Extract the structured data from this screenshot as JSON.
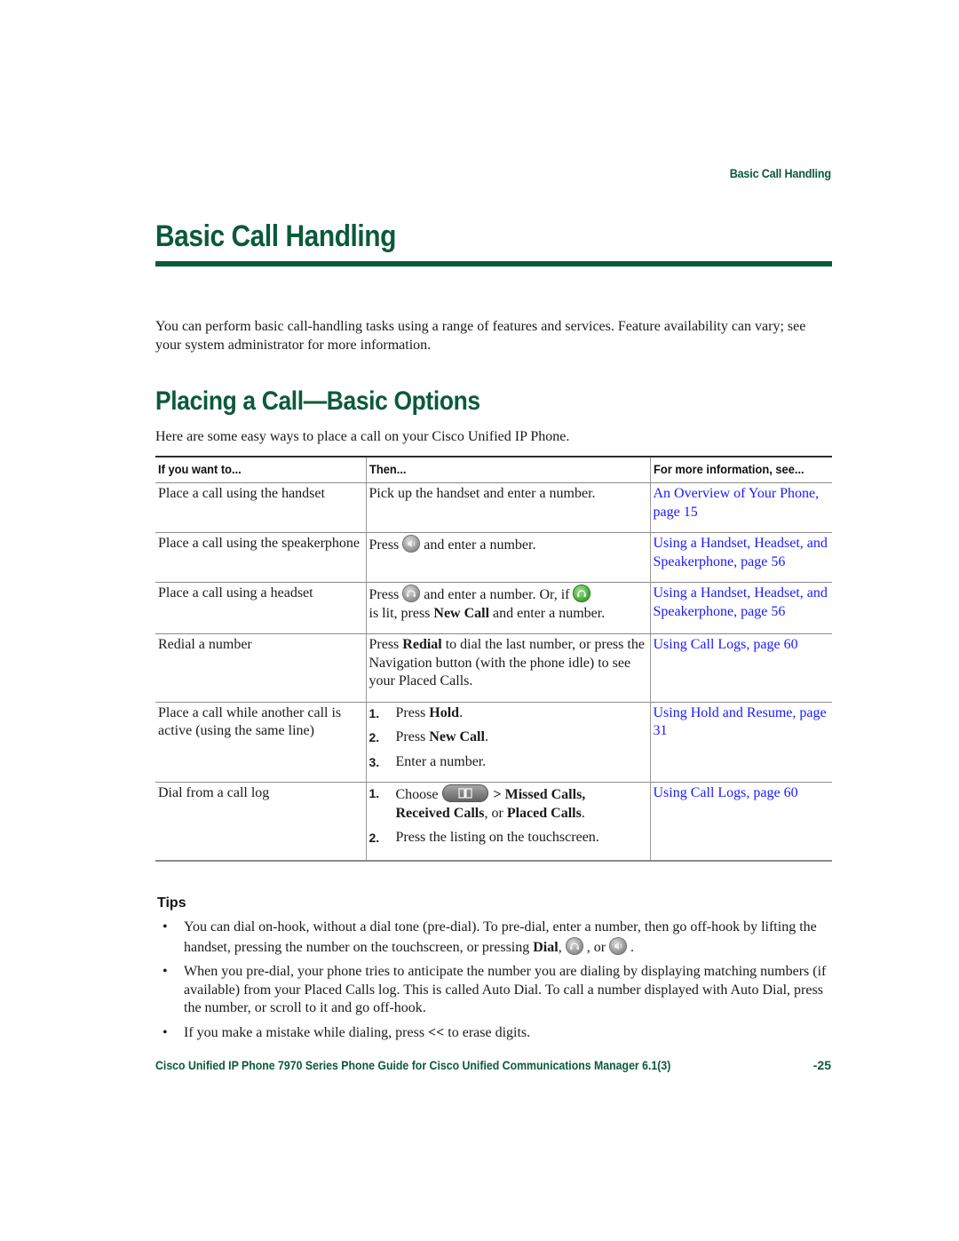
{
  "running_header": "Basic Call Handling",
  "page_title": "Basic Call Handling",
  "intro": "You can perform basic call-handling tasks using a range of features and services. Feature availability can vary; see your system administrator for more information.",
  "section": {
    "title": "Placing a Call—Basic Options",
    "intro": "Here are some easy ways to place a call on your Cisco Unified IP Phone."
  },
  "table": {
    "headers": [
      "If you want to...",
      "Then...",
      "For more information, see..."
    ],
    "rows": [
      {
        "want": "Place a call using the handset",
        "then": "Pick up the handset and enter a number.",
        "see": "An Overview of Your Phone, page 15"
      },
      {
        "want": "Place a call using the speakerphone",
        "then_pre": "Press",
        "then_icon": "speaker-icon",
        "then_post": "and enter a number.",
        "see": "Using a Handset, Headset, and Speakerphone, page 56"
      },
      {
        "want": "Place a call using a headset",
        "then_pre": "Press",
        "then_icon": "headset-icon",
        "then_mid": "and enter a number. Or, if",
        "then_icon2": "headset-lit-icon",
        "then_mid2": "is lit, press",
        "then_bold": "New Call",
        "then_post": "and enter a number.",
        "see": "Using a Handset, Headset, and Speakerphone, page 56"
      },
      {
        "want": "Redial a number",
        "then_pre": "Press",
        "then_bold": "Redial",
        "then_post": "to dial the last number, or press the Navigation button (with the phone idle) to see your Placed Calls.",
        "see": "Using Call Logs, page 60"
      },
      {
        "want": "Place a call while another call is active (using the same line)",
        "steps": [
          {
            "num": "1.",
            "pre": "Press",
            "bold": "Hold",
            "post": "."
          },
          {
            "num": "2.",
            "pre": "Press",
            "bold": "New Call",
            "post": "."
          },
          {
            "num": "3.",
            "pre": "Enter a number.",
            "bold": "",
            "post": ""
          }
        ],
        "see": "Using Hold and Resume, page 31"
      },
      {
        "want": "Dial from a call log",
        "steps": [
          {
            "num": "1.",
            "pre": "Choose",
            "icon": "directories-icon",
            "bold": "> Missed Calls,",
            "line2_bold1": "Received Calls",
            "line2_mid": ", or",
            "line2_bold2": "Placed Calls",
            "line2_post": "."
          },
          {
            "num": "2.",
            "pre": "Press the listing on the touchscreen."
          }
        ],
        "see": "Using Call Logs, page 60"
      }
    ]
  },
  "tips": {
    "heading": "Tips",
    "bullet": "•",
    "items": [
      {
        "pre": "You can dial on-hook, without a dial tone (pre-dial). To pre-dial, enter a number, then go off-hook by lifting the handset, pressing the number on the touchscreen, or pressing",
        "bold": "Dial",
        "icons": [
          "headset-icon",
          "speaker-icon"
        ],
        "sep1": ",",
        "sep2": ", or",
        "end": "."
      },
      {
        "text": "When you pre-dial, your phone tries to anticipate the number you are dialing by displaying matching numbers (if available) from your Placed Calls log. This is called Auto Dial. To call a number displayed with Auto Dial, press the number, or scroll to it and go off-hook."
      },
      {
        "pre": "If you make a mistake while dialing, press",
        "bold": "<<",
        "post": "to erase digits."
      }
    ]
  },
  "footer": {
    "title": "Cisco Unified IP Phone 7970 Series Phone Guide for Cisco Unified Communications Manager 6.1(3)",
    "page": "-25"
  },
  "colors": {
    "heading_green": "#0b5a3a",
    "link_blue": "#1a1aff",
    "lit_green": "#3aa52e"
  }
}
